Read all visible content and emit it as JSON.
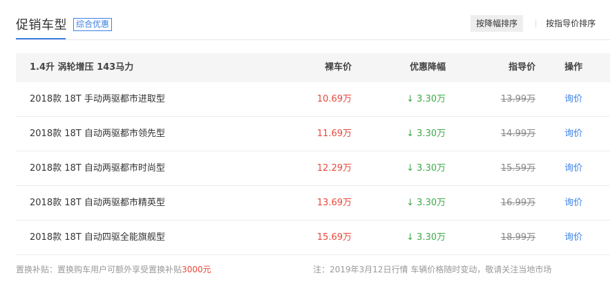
{
  "header": {
    "title": "促销车型",
    "tag": "综合优惠",
    "sort_active": "按降幅排序",
    "sort_other": "按指导价排序"
  },
  "table": {
    "group_label": "1.4升 涡轮增压 143马力",
    "columns": {
      "price": "裸车价",
      "discount": "优惠降幅",
      "guide": "指导价",
      "action": "操作"
    },
    "rows": [
      {
        "name": "2018款 18T 手动两驱都市进取型",
        "price": "10.69万",
        "discount": "3.30万",
        "guide": "13.99万",
        "action": "询价"
      },
      {
        "name": "2018款 18T 自动两驱都市领先型",
        "price": "11.69万",
        "discount": "3.30万",
        "guide": "14.99万",
        "action": "询价"
      },
      {
        "name": "2018款 18T 自动两驱都市时尚型",
        "price": "12.29万",
        "discount": "3.30万",
        "guide": "15.59万",
        "action": "询价"
      },
      {
        "name": "2018款 18T 自动两驱都市精英型",
        "price": "13.69万",
        "discount": "3.30万",
        "guide": "16.99万",
        "action": "询价"
      },
      {
        "name": "2018款 18T 自动四驱全能旗舰型",
        "price": "15.69万",
        "discount": "3.30万",
        "guide": "18.99万",
        "action": "询价"
      }
    ]
  },
  "footer": {
    "subsidy_text": "置换补贴：置换购车用户可额外享受置换补贴",
    "subsidy_amount": "3000元",
    "note": "注：2019年3月12日行情 车辆价格随时变动，敬请关注当地市场"
  },
  "colors": {
    "accent": "#3b80e6",
    "price": "#e8473a",
    "discount": "#3daa49"
  },
  "icons": {
    "discount_arrow": "arrow-down-icon"
  }
}
